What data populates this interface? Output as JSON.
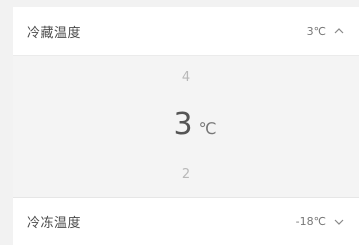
{
  "fridge": {
    "label": "冷藏温度",
    "value": "3℃",
    "expanded": true
  },
  "picker": {
    "above": "4",
    "current": "3",
    "unit": "℃",
    "below": "2"
  },
  "freezer": {
    "label": "冷冻温度",
    "value": "-18℃",
    "expanded": false
  },
  "icons": {
    "fridge_chevron": "chevron-up-icon",
    "freezer_chevron": "chevron-down-icon"
  }
}
